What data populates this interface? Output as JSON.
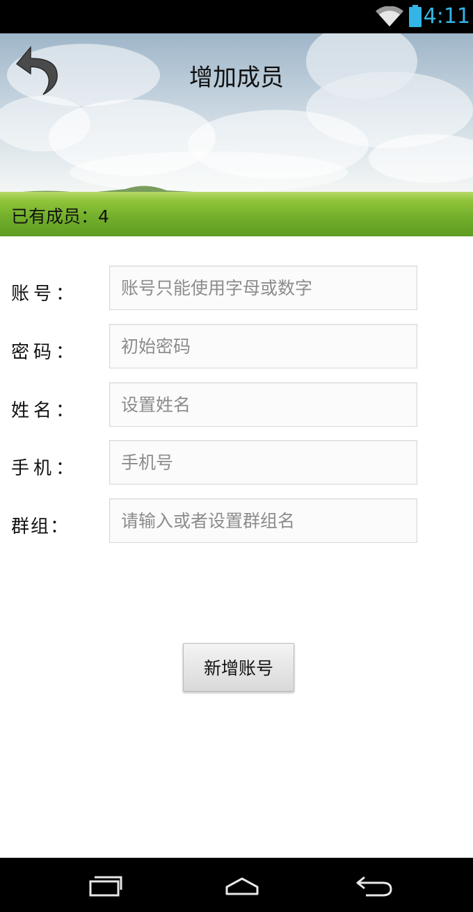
{
  "status_bar": {
    "time": "4:11",
    "icons": [
      "wifi-icon",
      "battery-icon"
    ],
    "accent_color": "#33b5e5"
  },
  "header": {
    "back_icon": "back-arrow-icon",
    "title": "增加成员",
    "member_count": "已有成员：4"
  },
  "form": {
    "fields": [
      {
        "label": "账号：",
        "placeholder": "账号只能使用字母或数字"
      },
      {
        "label": "密码：",
        "placeholder": "初始密码"
      },
      {
        "label": "姓名：",
        "placeholder": "设置姓名"
      },
      {
        "label": "手机：",
        "placeholder": "手机号"
      },
      {
        "label": "群组：",
        "placeholder": "请输入或者设置群组名"
      }
    ],
    "submit_label": "新增账号"
  },
  "nav_bar": {
    "buttons": [
      "recent-apps-icon",
      "home-icon",
      "back-icon"
    ]
  }
}
